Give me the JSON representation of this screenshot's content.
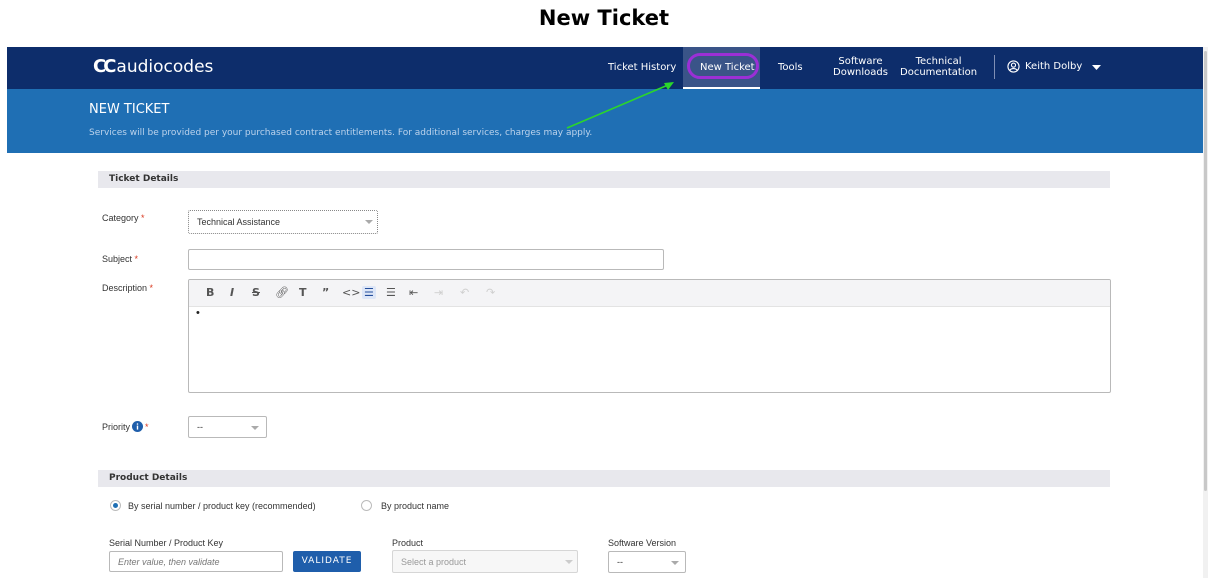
{
  "page_title": "New Ticket",
  "brand": {
    "name": "audiocodes",
    "mark": "CC"
  },
  "nav": {
    "items": [
      {
        "label": "Ticket History"
      },
      {
        "label": "New Ticket",
        "active": true
      },
      {
        "label": "Tools"
      },
      {
        "label": "Software\nDownloads"
      },
      {
        "label": "Technical\nDocumentation"
      }
    ],
    "user": "Keith Dolby"
  },
  "banner": {
    "title": "NEW TICKET",
    "subtitle": "Services will be provided per your purchased contract entitlements. For additional services, charges may apply."
  },
  "ticket_details": {
    "section_title": "Ticket Details",
    "category_label": "Category",
    "category_value": "Technical Assistance",
    "subject_label": "Subject",
    "subject_value": "",
    "description_label": "Description",
    "description_bullet": "•",
    "priority_label": "Priority",
    "priority_value": "--",
    "required_marker": "*"
  },
  "editor_toolbar": [
    "B",
    "I",
    "S",
    "link",
    "Tt",
    "99",
    "<>",
    "ul",
    "ol",
    "outdent",
    "indent",
    "undo",
    "redo"
  ],
  "product_details": {
    "section_title": "Product Details",
    "radio_serial": "By serial number / product key (recommended)",
    "radio_product": "By product name",
    "serial_label": "Serial Number / Product Key",
    "serial_placeholder": "Enter value, then validate",
    "validate_label": "VALIDATE",
    "product_label": "Product",
    "product_placeholder": "Select a product",
    "version_label": "Software Version",
    "version_value": "--"
  },
  "colors": {
    "navbar": "#0d2d6b",
    "banner": "#1f6fb4",
    "accent_ring": "#9b2fd6",
    "arrow": "#2bd62b",
    "validate": "#1f5eab"
  }
}
